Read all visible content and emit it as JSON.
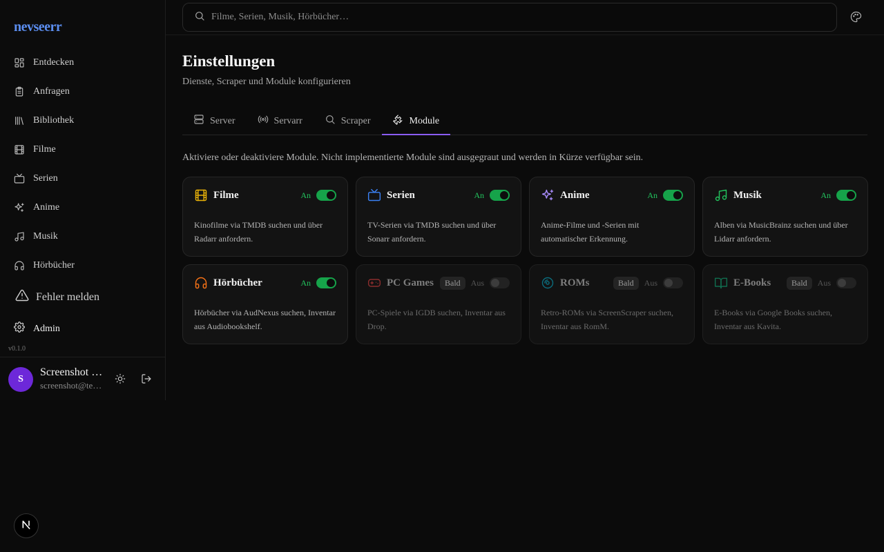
{
  "app": {
    "logo": "nevseerr",
    "version": "v0.1.0"
  },
  "sidebar": {
    "items": [
      {
        "label": "Entdecken",
        "icon": "layout-grid-icon"
      },
      {
        "label": "Anfragen",
        "icon": "clipboard-list-icon"
      },
      {
        "label": "Bibliothek",
        "icon": "library-icon"
      },
      {
        "label": "Filme",
        "icon": "film-icon"
      },
      {
        "label": "Serien",
        "icon": "tv-icon"
      },
      {
        "label": "Anime",
        "icon": "sparkles-icon"
      },
      {
        "label": "Musik",
        "icon": "music-icon"
      },
      {
        "label": "Hörbücher",
        "icon": "headphones-icon"
      }
    ],
    "report_label": "Fehler melden",
    "admin_label": "Admin"
  },
  "user": {
    "initial": "S",
    "name": "Screenshot User",
    "email": "screenshot@test.local"
  },
  "search": {
    "placeholder": "Filme, Serien, Musik, Hörbücher…"
  },
  "page": {
    "title": "Einstellungen",
    "subtitle": "Dienste, Scraper und Module konfigurieren",
    "description": "Aktiviere oder deaktiviere Module. Nicht implementierte Module sind ausgegraut und werden in Kürze verfügbar sein."
  },
  "tabs": [
    {
      "label": "Server",
      "icon": "server-icon",
      "active": false
    },
    {
      "label": "Servarr",
      "icon": "radio-icon",
      "active": false
    },
    {
      "label": "Scraper",
      "icon": "search-icon",
      "active": false
    },
    {
      "label": "Module",
      "icon": "puzzle-icon",
      "active": true
    }
  ],
  "modules": [
    {
      "name": "Filme",
      "icon": "film-icon",
      "color": "#eab308",
      "state": "An",
      "enabled": true,
      "soon": false,
      "description": "Kinofilme via TMDB suchen und über Radarr anfordern."
    },
    {
      "name": "Serien",
      "icon": "tv-icon",
      "color": "#3b82f6",
      "state": "An",
      "enabled": true,
      "soon": false,
      "description": "TV-Serien via TMDB suchen und über Sonarr anfordern."
    },
    {
      "name": "Anime",
      "icon": "sparkles-icon",
      "color": "#a78bfa",
      "state": "An",
      "enabled": true,
      "soon": false,
      "description": "Anime-Filme und -Serien mit automatischer Erkennung."
    },
    {
      "name": "Musik",
      "icon": "music-icon",
      "color": "#22c55e",
      "state": "An",
      "enabled": true,
      "soon": false,
      "description": "Alben via MusicBrainz suchen und über Lidarr anfordern."
    },
    {
      "name": "Hörbücher",
      "icon": "headphones-icon",
      "color": "#f97316",
      "state": "An",
      "enabled": true,
      "soon": false,
      "description": "Hörbücher via AudNexus suchen, Inventar aus Audiobookshelf."
    },
    {
      "name": "PC Games",
      "icon": "gamepad-icon",
      "color": "#ef4444",
      "state": "Aus",
      "enabled": false,
      "soon": true,
      "badge": "Bald",
      "description": "PC-Spiele via IGDB suchen, Inventar aus Drop."
    },
    {
      "name": "ROMs",
      "icon": "disc-icon",
      "color": "#06b6d4",
      "state": "Aus",
      "enabled": false,
      "soon": true,
      "badge": "Bald",
      "description": "Retro-ROMs via ScreenScraper suchen, Inventar aus RomM."
    },
    {
      "name": "E-Books",
      "icon": "book-open-icon",
      "color": "#10b981",
      "state": "Aus",
      "enabled": false,
      "soon": true,
      "badge": "Bald",
      "description": "E-Books via Google Books suchen, Inventar aus Kavita."
    }
  ]
}
